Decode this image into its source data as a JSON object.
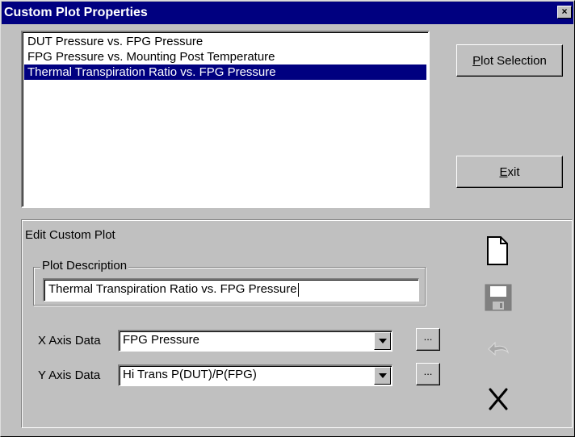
{
  "window": {
    "title": "Custom Plot Properties",
    "close_glyph": "×"
  },
  "plot_list": {
    "items": [
      {
        "label": "DUT Pressure vs. FPG Pressure",
        "selected": false
      },
      {
        "label": "FPG Pressure vs. Mounting Post Temperature",
        "selected": false
      },
      {
        "label": "Thermal Transpiration Ratio vs. FPG Pressure",
        "selected": true
      }
    ]
  },
  "buttons": {
    "plot_selection": {
      "mnemonic": "P",
      "rest": "lot Selection"
    },
    "exit": {
      "mnemonic": "E",
      "rest": "xit"
    }
  },
  "edit_group": {
    "label": "Edit Custom Plot",
    "description_label": "Plot Description",
    "description_value": "Thermal Transpiration Ratio vs. FPG Pressure",
    "x_axis_label": "X Axis Data",
    "x_axis_value": "FPG Pressure",
    "y_axis_label": "Y Axis Data",
    "y_axis_value": "Hi Trans P(DUT)/P(FPG)",
    "ellipsis": "..."
  },
  "toolbar_icons": [
    "new-document-icon",
    "save-disk-icon",
    "undo-icon",
    "delete-icon"
  ],
  "colors": {
    "face": "#c0c0c0",
    "title_bar": "#000080",
    "selection": "#000080"
  }
}
